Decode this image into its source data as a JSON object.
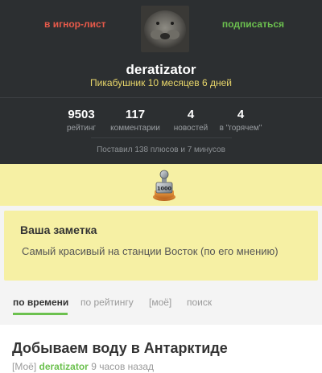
{
  "profile": {
    "ignore_label": "в игнор-лист",
    "subscribe_label": "подписаться",
    "username": "deratizator",
    "since": "Пикабушник 10 месяцев 6 дней",
    "stats": {
      "rating": {
        "value": "9503",
        "label": "рейтинг"
      },
      "comments": {
        "value": "117",
        "label": "комментарии"
      },
      "news": {
        "value": "4",
        "label": "новостей"
      },
      "hot": {
        "value": "4",
        "label": "в \"горячем\""
      }
    },
    "votes_text": "Поставил 138 плюсов и 7 минусов"
  },
  "awards": {
    "medal_text": "1000",
    "medal_icon": "award-medal-icon"
  },
  "note": {
    "title": "Ваша заметка",
    "text": "Самый красивый на станции Восток (по его мнению)"
  },
  "tabs": [
    {
      "label": "по времени",
      "active": true
    },
    {
      "label": "по рейтингу",
      "active": false
    },
    {
      "label": "[моё]",
      "active": false
    },
    {
      "label": "поиск",
      "active": false
    }
  ],
  "post": {
    "title": "Добываем воду в Антарктиде",
    "tag": "[Моё]",
    "author": "deratizator",
    "time": "9 часов назад"
  },
  "colors": {
    "header_bg": "#2c2f31",
    "accent_green": "#6cc14f",
    "ignore_red": "#e85a4a",
    "since_yellow": "#e8d66a",
    "note_bg": "#f6f0a4"
  }
}
